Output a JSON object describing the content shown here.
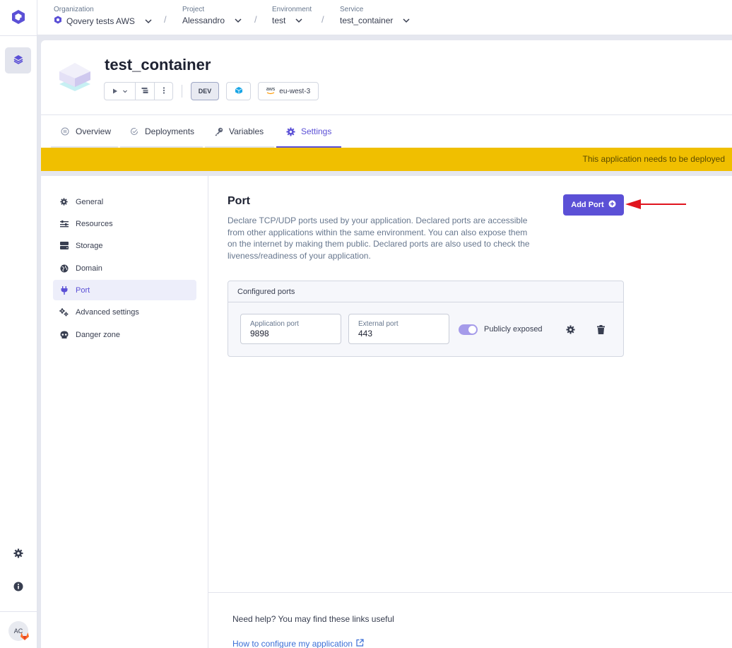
{
  "breadcrumb": {
    "organization": {
      "label": "Organization",
      "value": "Qovery tests AWS"
    },
    "project": {
      "label": "Project",
      "value": "Alessandro"
    },
    "environment": {
      "label": "Environment",
      "value": "test"
    },
    "service": {
      "label": "Service",
      "value": "test_container"
    },
    "separator": "/"
  },
  "user": {
    "initials": "AC"
  },
  "service": {
    "name": "test_container",
    "env_tag": "DEV",
    "region": "eu-west-3",
    "cloud_label": "aws"
  },
  "tabs": [
    {
      "label": "Overview",
      "icon": "pause-circle-icon"
    },
    {
      "label": "Deployments",
      "icon": "check-circle-icon"
    },
    {
      "label": "Variables",
      "icon": "key-icon"
    },
    {
      "label": "Settings",
      "icon": "gear-icon",
      "active": true
    }
  ],
  "banner": {
    "text": "This application needs to be deployed"
  },
  "settings_nav": [
    {
      "label": "General",
      "icon": "gear-icon"
    },
    {
      "label": "Resources",
      "icon": "sliders-icon"
    },
    {
      "label": "Storage",
      "icon": "hard-drive-icon"
    },
    {
      "label": "Domain",
      "icon": "globe-icon"
    },
    {
      "label": "Port",
      "icon": "plug-icon",
      "active": true
    },
    {
      "label": "Advanced settings",
      "icon": "gears-icon"
    },
    {
      "label": "Danger zone",
      "icon": "skull-icon"
    }
  ],
  "port_section": {
    "title": "Port",
    "description": "Declare TCP/UDP ports used by your application. Declared ports are accessible from other applications within the same environment. You can also expose them on the internet by making them public. Declared ports are also used to check the liveness/readiness of your application.",
    "add_button": "Add Port",
    "configured_title": "Configured ports",
    "ports": [
      {
        "application_port_label": "Application port",
        "application_port": "9898",
        "external_port_label": "External port",
        "external_port": "443",
        "publicly_exposed_label": "Publicly exposed",
        "publicly_exposed": true
      }
    ]
  },
  "help": {
    "text": "Need help? You may find these links useful",
    "link": "How to configure my application"
  },
  "colors": {
    "accent": "#5b50d6",
    "banner": "#f0bf00",
    "annotation_arrow": "#e0141e",
    "link": "#3b6fd6"
  }
}
